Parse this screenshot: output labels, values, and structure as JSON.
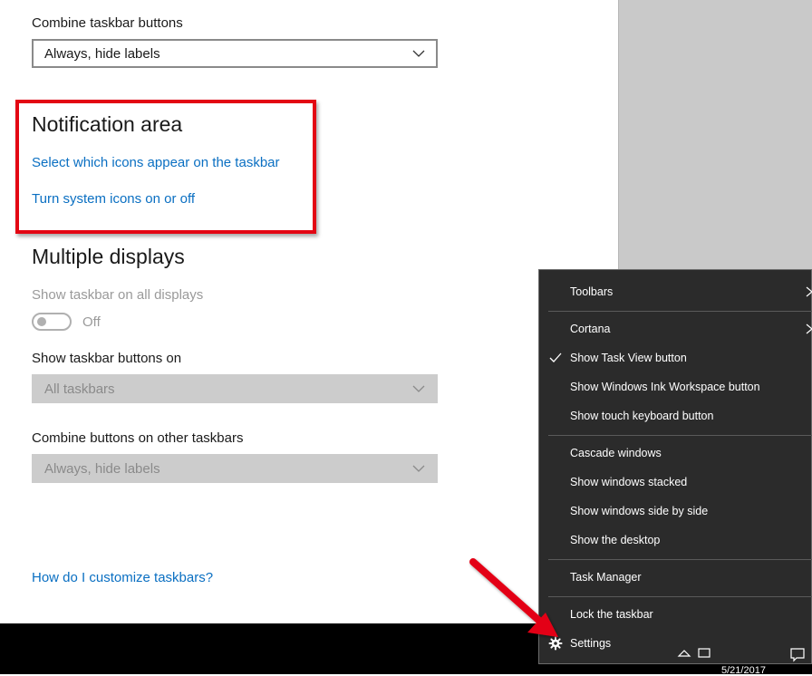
{
  "settings": {
    "combine_label": "Combine taskbar buttons",
    "combine_value": "Always, hide labels",
    "notification_heading": "Notification area",
    "link_icons": "Select which icons appear on the taskbar",
    "link_system_icons": "Turn system icons on or off",
    "multiple_heading": "Multiple displays",
    "show_all_label": "Show taskbar on all displays",
    "toggle_state": "Off",
    "buttons_on_label": "Show taskbar buttons on",
    "buttons_on_value": "All taskbars",
    "combine_other_label": "Combine buttons on other taskbars",
    "combine_other_value": "Always, hide labels",
    "help_link": "How do I customize taskbars?"
  },
  "menu": {
    "toolbars": "Toolbars",
    "cortana": "Cortana",
    "task_view": "Show Task View button",
    "ink": "Show Windows Ink Workspace button",
    "touch_kb": "Show touch keyboard button",
    "cascade": "Cascade windows",
    "stacked": "Show windows stacked",
    "side_by_side": "Show windows side by side",
    "desktop": "Show the desktop",
    "task_manager": "Task Manager",
    "lock": "Lock the taskbar",
    "settings": "Settings"
  },
  "taskbar": {
    "date": "5/21/2017"
  },
  "colors": {
    "link": "#0a6fc2",
    "highlight": "#e30613",
    "menu_bg": "#2b2b2b"
  }
}
